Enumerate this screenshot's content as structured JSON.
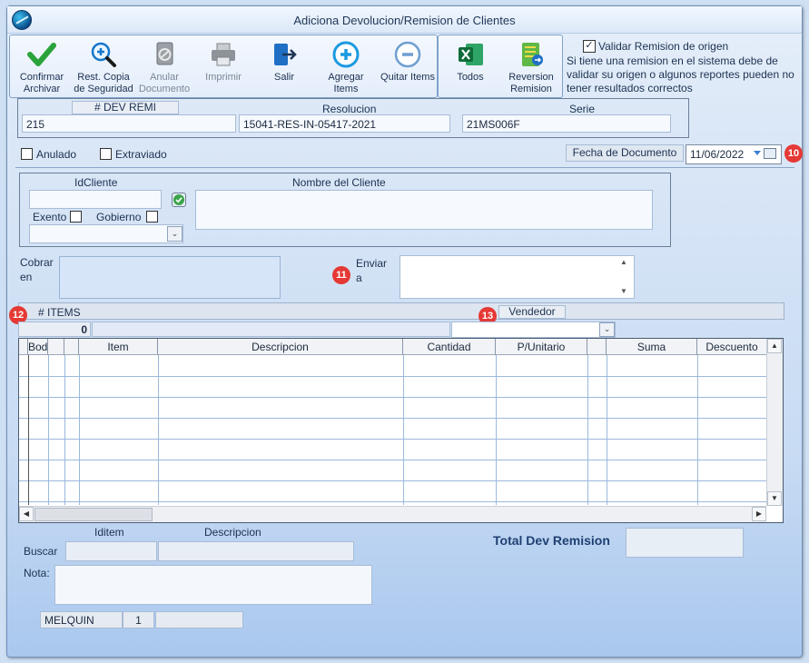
{
  "window": {
    "title": "Adiciona Devolucion/Remision de Clientes"
  },
  "toolbar": {
    "confirm": "Confirmar Archivar",
    "restore": "Rest. Copia de Seguridad",
    "void": "Anular Documento",
    "print": "Imprimir",
    "exit": "Salir",
    "add_items": "Agregar Items",
    "remove_items": "Quitar Items",
    "all": "Todos",
    "reversal": "Reversion Remision"
  },
  "validate": {
    "label": "Validar Remision de origen",
    "checked": true,
    "note": "Si tiene una remision en el sistema debe de validar su origen o algunos reportes pueden no tener resultados correctos"
  },
  "header": {
    "dev_remi_label": "# DEV REMI",
    "dev_remi_value": "215",
    "resolucion_label": "Resolucion",
    "resolucion_value": "15041-RES-IN-05417-2021",
    "serie_label": "Serie",
    "serie_value": "21MS006F"
  },
  "status": {
    "anulado": "Anulado",
    "extraviado": "Extraviado"
  },
  "fecha": {
    "label": "Fecha de  Documento",
    "value": "11/06/2022"
  },
  "cliente": {
    "id_label": "IdCliente",
    "id_value": "",
    "name_label": "Nombre del Cliente",
    "name_value": "",
    "exento": "Exento",
    "gobierno": "Gobierno"
  },
  "cobrar": {
    "label_1": "Cobrar",
    "label_2": "en"
  },
  "enviar": {
    "label_1": "Enviar",
    "label_2": "a"
  },
  "markers": {
    "m10": "10",
    "m11": "11",
    "m12": "12",
    "m13": "13"
  },
  "items": {
    "label": "# ITEMS",
    "count": "0",
    "vendedor_label": "Vendedor"
  },
  "grid": {
    "columns": [
      "Bodega",
      "Item",
      "Descripcion",
      "Cantidad",
      "P/Unitario",
      "",
      "Suma",
      "Descuento"
    ]
  },
  "search": {
    "iditem_label": "Iditem",
    "descripcion_label": "Descripcion",
    "buscar_label": "Buscar",
    "nota_label": "Nota:"
  },
  "total": {
    "label": "Total Dev Remision",
    "value": ""
  },
  "footer": {
    "user": "MELQUIN",
    "station": "1",
    "extra": ""
  },
  "colors": {
    "marker": "#e53935",
    "accent": "#1f3f72"
  }
}
